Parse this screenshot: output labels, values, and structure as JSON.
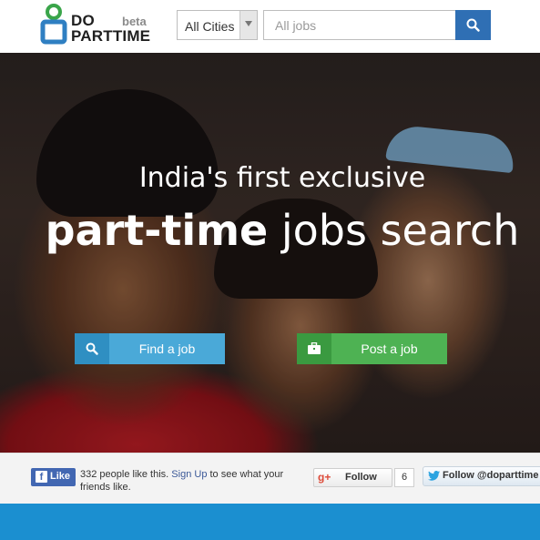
{
  "header": {
    "logo_line1": "DO",
    "logo_line2": "PARTTIME",
    "logo_beta": "beta",
    "city_select": "All Cities",
    "search_placeholder": "All jobs",
    "search_icon": "search-icon",
    "dropdown_icon": "triangle-down-icon"
  },
  "hero": {
    "subtitle": "India's first exclusive",
    "title_bold": "part-time",
    "title_rest": " jobs search",
    "find_job_label": "Find a job",
    "find_job_icon": "search-icon",
    "post_job_label": "Post a job",
    "post_job_icon": "briefcase-icon"
  },
  "social": {
    "fb_like_label": "Like",
    "fb_count_text": "332 people like this.",
    "fb_signup": "Sign Up",
    "fb_suffix": " to see what your friends like.",
    "gplus_label": "Follow",
    "gplus_count": "6",
    "twitter_label": "Follow @doparttime"
  },
  "colors": {
    "search_button": "#2f6fb4",
    "find_job": "#4aa9d8",
    "post_job": "#4eb253",
    "facebook": "#4267b2",
    "bottom_band": "#1b8fd0"
  }
}
